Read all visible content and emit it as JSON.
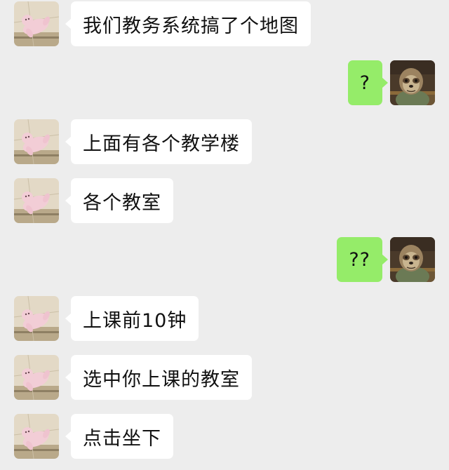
{
  "colors": {
    "background": "#ededed",
    "incoming_bubble": "#ffffff",
    "outgoing_bubble": "#95ec69",
    "text": "#111111"
  },
  "messages": [
    {
      "side": "left",
      "avatar": "bear-sticker-avatar",
      "text": "我们教务系统搞了个地图"
    },
    {
      "side": "right",
      "avatar": "sloth-avatar",
      "text": "?"
    },
    {
      "side": "left",
      "avatar": "bear-sticker-avatar",
      "text": "上面有各个教学楼"
    },
    {
      "side": "left",
      "avatar": "bear-sticker-avatar",
      "text": "各个教室"
    },
    {
      "side": "right",
      "avatar": "sloth-avatar",
      "text": "??"
    },
    {
      "side": "left",
      "avatar": "bear-sticker-avatar",
      "text": "上课前10钟"
    },
    {
      "side": "left",
      "avatar": "bear-sticker-avatar",
      "text": "选中你上课的教室"
    },
    {
      "side": "left",
      "avatar": "bear-sticker-avatar",
      "text": "点击坐下"
    }
  ]
}
